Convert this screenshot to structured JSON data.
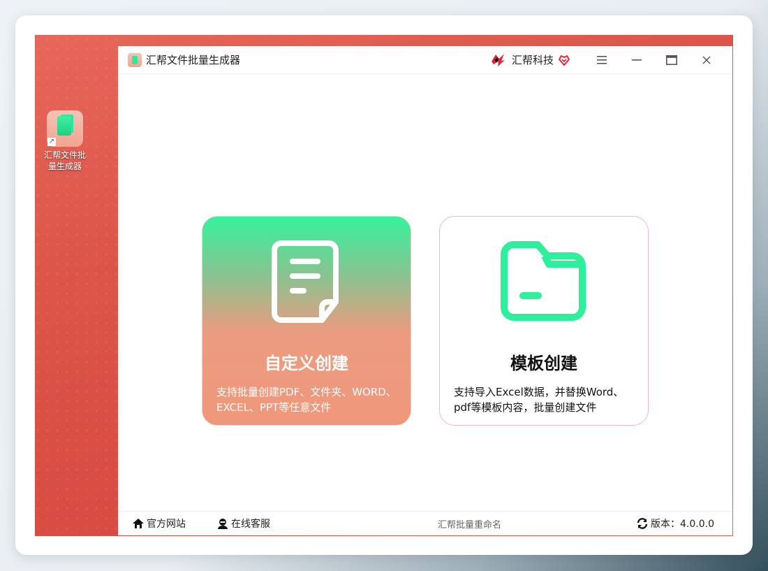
{
  "desktop": {
    "shortcut_label_line1": "汇帮文件批",
    "shortcut_label_line2": "量生成器",
    "shortcut_icon": "app-shortcut-icon"
  },
  "window": {
    "title": "汇帮文件批量生成器",
    "brand_name": "汇帮科技",
    "controls": [
      "menu-icon",
      "minimize-icon",
      "maximize-icon",
      "close-icon"
    ]
  },
  "cards": {
    "custom": {
      "title": "自定义创建",
      "description": "支持批量创建PDF、文件夹、WORD、EXCEL、PPT等任意文件",
      "icon": "document-icon"
    },
    "template": {
      "title": "模板创建",
      "description": "支持导入Excel数据，并替换Word、pdf等模板内容，批量创建文件",
      "icon": "folder-icon"
    }
  },
  "footer": {
    "website": "官方网站",
    "service": "在线客服",
    "center_text": "汇帮批量重命名",
    "version": "版本：4.0.0.0"
  },
  "colors": {
    "accent_green": "#2ff09a",
    "card_gradient_top": "#36f29c",
    "card_gradient_bottom": "#f0977b",
    "template_border": "#f4b7c4",
    "brand_red": "#e3233b"
  }
}
